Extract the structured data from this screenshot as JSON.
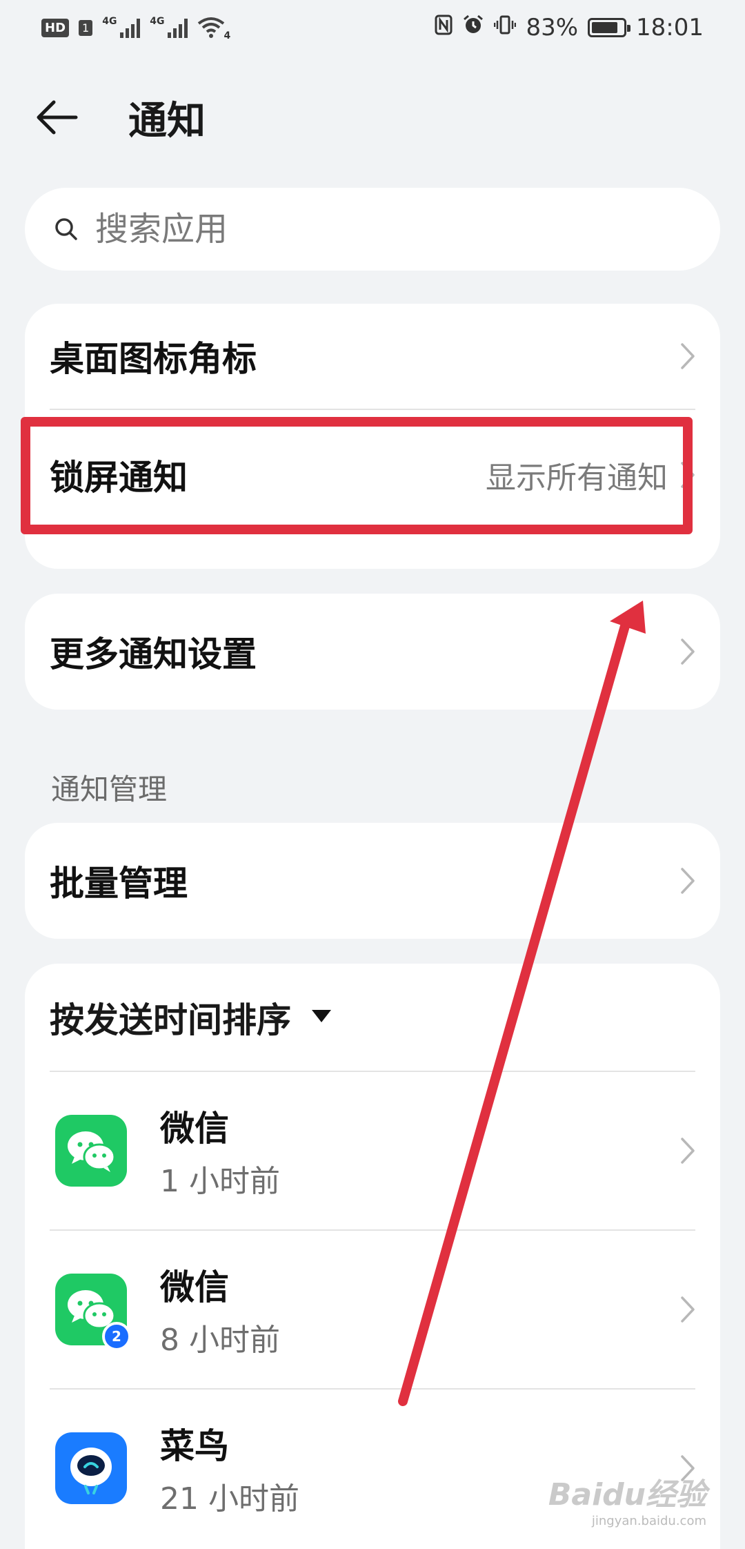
{
  "status_bar": {
    "hd": "HD",
    "sim": "1",
    "signal1_tag": "4G",
    "signal2_tag": "4G",
    "wifi_tag": "4",
    "battery_percent": "83%",
    "battery_level": 0.83,
    "time": "18:01",
    "icons": [
      "nfc-icon",
      "alarm-icon",
      "vibrate-icon"
    ]
  },
  "header": {
    "title": "通知"
  },
  "search": {
    "placeholder": "搜索应用"
  },
  "settings_card": {
    "rows": [
      {
        "label": "桌面图标角标",
        "value": ""
      },
      {
        "label": "锁屏通知",
        "value": "显示所有通知"
      }
    ]
  },
  "more_card": {
    "label": "更多通知设置"
  },
  "section": {
    "label": "通知管理"
  },
  "batch_card": {
    "label": "批量管理"
  },
  "apps_card": {
    "sort_label": "按发送时间排序",
    "apps": [
      {
        "name": "微信",
        "time": "1 小时前",
        "icon": "wechat-icon",
        "color": "#1fc964"
      },
      {
        "name": "微信",
        "time": "8 小时前",
        "icon": "wechat-clone-icon",
        "color": "#1fc964",
        "badge": "2"
      },
      {
        "name": "菜鸟",
        "time": "21 小时前",
        "icon": "cainiao-icon",
        "color": "#1a7cff"
      }
    ]
  },
  "annotation_color": "#e0303f",
  "watermark": {
    "brand": "Baidu经验",
    "url": "jingyan.baidu.com"
  }
}
